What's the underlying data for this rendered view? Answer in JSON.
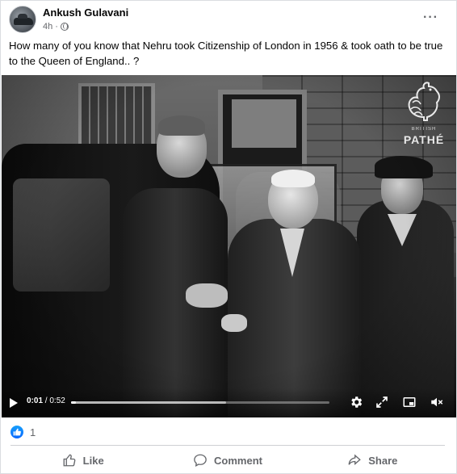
{
  "post": {
    "author": "Ankush Gulavani",
    "timestamp": "4h",
    "separator": "·",
    "audience_icon": "globe-icon",
    "more_label": "···",
    "text": "How many of you know that Nehru took Citizenship of London in 1956 & took oath to be true to the Queen of England.. ?"
  },
  "video": {
    "watermark_small": "BRITISH",
    "watermark_big": "PATHÉ",
    "current_time": "0:01",
    "duration": "/ 0:52",
    "progress_fraction": 0.02,
    "buffered_fraction": 0.6,
    "icons": [
      "play-icon",
      "settings-gear-icon",
      "fullscreen-expand-icon",
      "picture-in-picture-icon",
      "volume-icon"
    ]
  },
  "reactions": {
    "count": "1",
    "icon": "like-reaction-icon"
  },
  "actions": {
    "like": "Like",
    "comment": "Comment",
    "share": "Share"
  },
  "colors": {
    "accent": "#0866ff",
    "secondary_text": "#65676b",
    "primary_text": "#050505"
  }
}
